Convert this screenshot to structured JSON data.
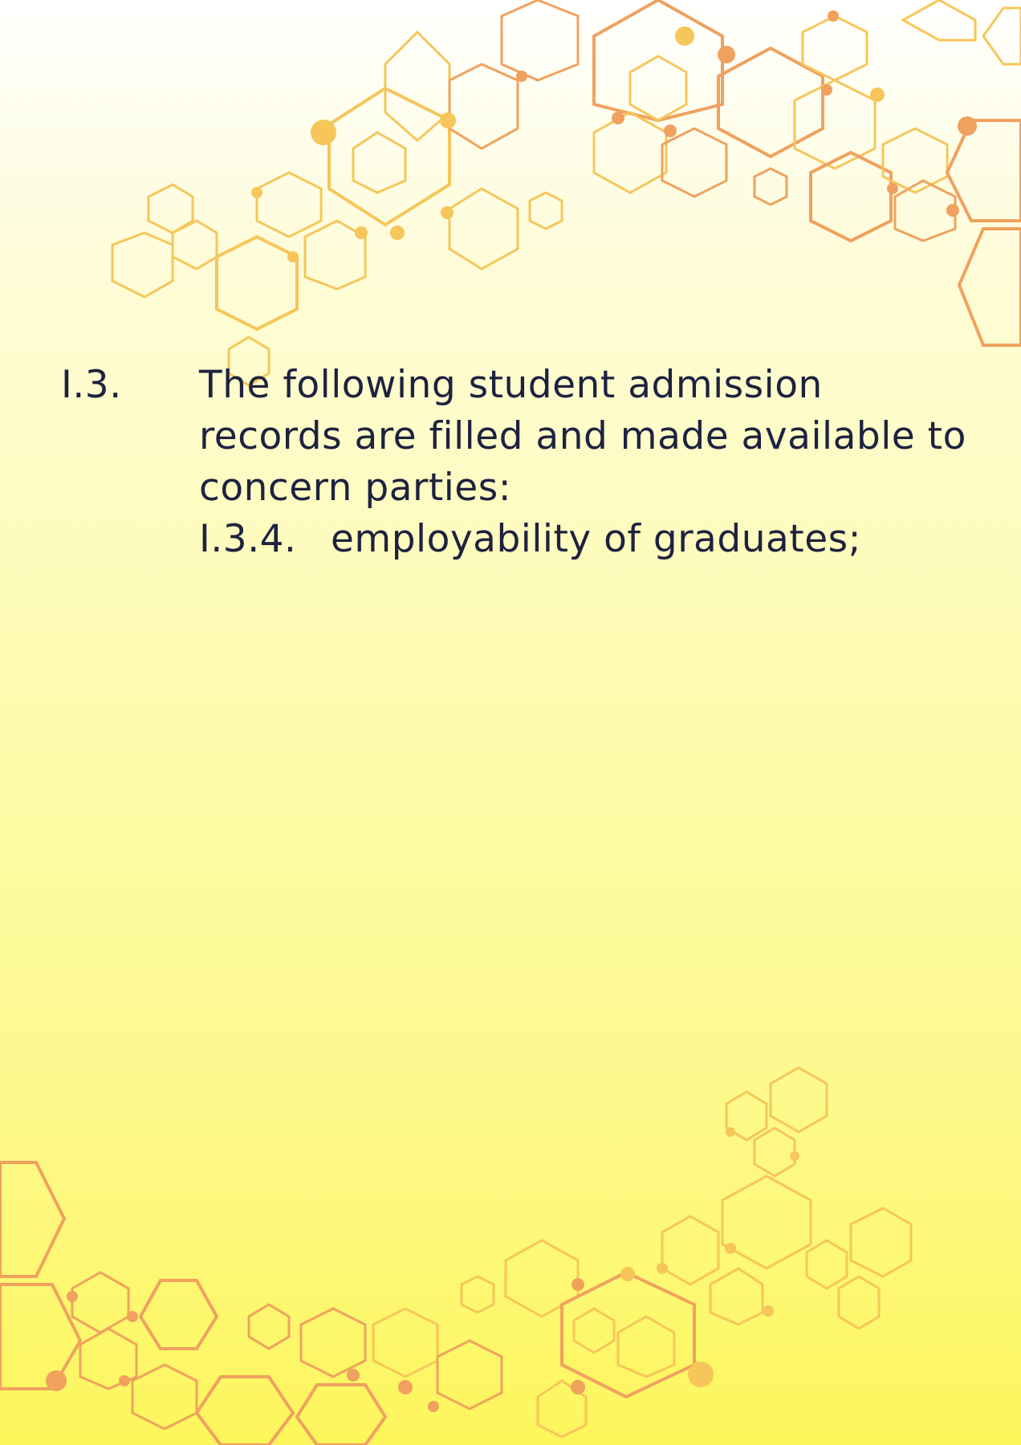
{
  "document": {
    "item": {
      "number": "I.3.",
      "text_line_1": "The following student admission",
      "text_line_2": "records are filled and made available to",
      "text_line_3": "concern parties:"
    },
    "subitem": {
      "number": "I.3.4.",
      "text": "employability of graduates;"
    }
  },
  "colors": {
    "text": "#1e2240",
    "hex_light": "#f6c65a",
    "hex_orange": "#f0a15e",
    "background_top": "#ffffff",
    "background_bottom": "#fdf65c"
  }
}
